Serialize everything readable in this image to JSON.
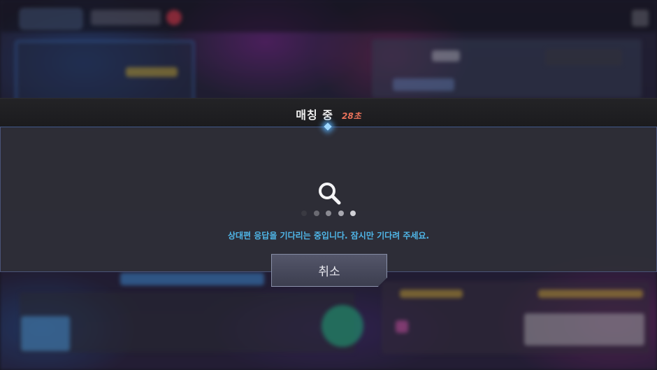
{
  "dialog": {
    "title": "매칭 중",
    "timer": "28초",
    "message": "상대편 응답을 기다리는 중입니다. 잠시만 기다려 주세요.",
    "cancel_label": "취소",
    "search_icon": "search-icon",
    "loading_dots": [
      {
        "state": "dim",
        "color": "#3a3a42"
      },
      {
        "state": "mid",
        "color": "#6a6a72"
      },
      {
        "state": "mid",
        "color": "#8a8a92"
      },
      {
        "state": "bright",
        "color": "#a8a8b0"
      },
      {
        "state": "bright",
        "color": "#d0d0d6"
      }
    ]
  },
  "colors": {
    "message": "#4fb6e8",
    "timer": "#e9725a",
    "accent_glow": "#9fd8ff"
  }
}
